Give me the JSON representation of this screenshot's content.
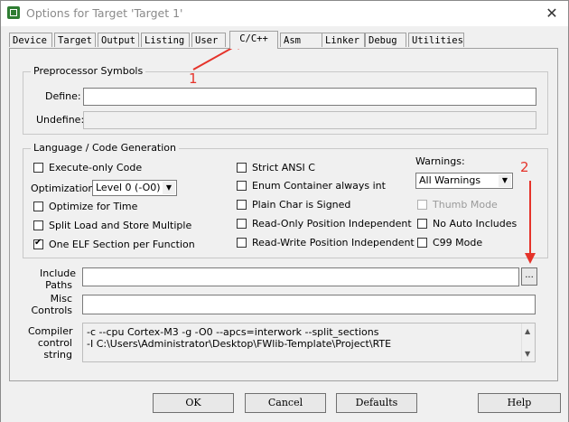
{
  "window": {
    "title": "Options for Target 'Target 1'",
    "close_glyph": "✕"
  },
  "tabs": [
    "Device",
    "Target",
    "Output",
    "Listing",
    "User",
    "C/C++",
    "Asm",
    "Linker",
    "Debug",
    "Utilities"
  ],
  "active_tab": "C/C++",
  "preprocessor": {
    "group_label": "Preprocessor Symbols",
    "define_label": "Define:",
    "define_value": "",
    "undefine_label": "Undefine:",
    "undefine_value": ""
  },
  "codegen": {
    "group_label": "Language / Code Generation",
    "execute_only": {
      "label": "Execute-only Code",
      "checked": false
    },
    "optimization_label": "Optimization:",
    "optimization_value": "Level 0 (-O0)",
    "optimize_time": {
      "label": "Optimize for Time",
      "checked": false
    },
    "split_load": {
      "label": "Split Load and Store Multiple",
      "checked": false
    },
    "one_elf": {
      "label": "One ELF Section per Function",
      "checked": true
    },
    "strict_ansi": {
      "label": "Strict ANSI C",
      "checked": false
    },
    "enum_int": {
      "label": "Enum Container always int",
      "checked": false
    },
    "plain_char": {
      "label": "Plain Char is Signed",
      "checked": false
    },
    "ro_pi": {
      "label": "Read-Only Position Independent",
      "checked": false
    },
    "rw_pi": {
      "label": "Read-Write Position Independent",
      "checked": false
    },
    "warnings_label": "Warnings:",
    "warnings_value": "All Warnings",
    "thumb_mode": {
      "label": "Thumb Mode",
      "checked": false,
      "disabled": true
    },
    "no_auto_includes": {
      "label": "No Auto Includes",
      "checked": false
    },
    "c99_mode": {
      "label": "C99 Mode",
      "checked": false
    }
  },
  "include": {
    "label_line1": "Include",
    "label_line2": "Paths",
    "value": "",
    "browse_label": "..."
  },
  "misc": {
    "label_line1": "Misc",
    "label_line2": "Controls",
    "value": ""
  },
  "compiler": {
    "label_line1": "Compiler",
    "label_line2": "control",
    "label_line3": "string",
    "line1": "-c --cpu Cortex-M3 -g -O0 --apcs=interwork --split_sections",
    "line2": "-I C:\\Users\\Administrator\\Desktop\\FWlib-Template\\Project\\RTE"
  },
  "buttons": {
    "ok": "OK",
    "cancel": "Cancel",
    "defaults": "Defaults",
    "help": "Help"
  },
  "annotations": {
    "marker1": "1",
    "marker2": "2",
    "color": "#e5332a"
  }
}
